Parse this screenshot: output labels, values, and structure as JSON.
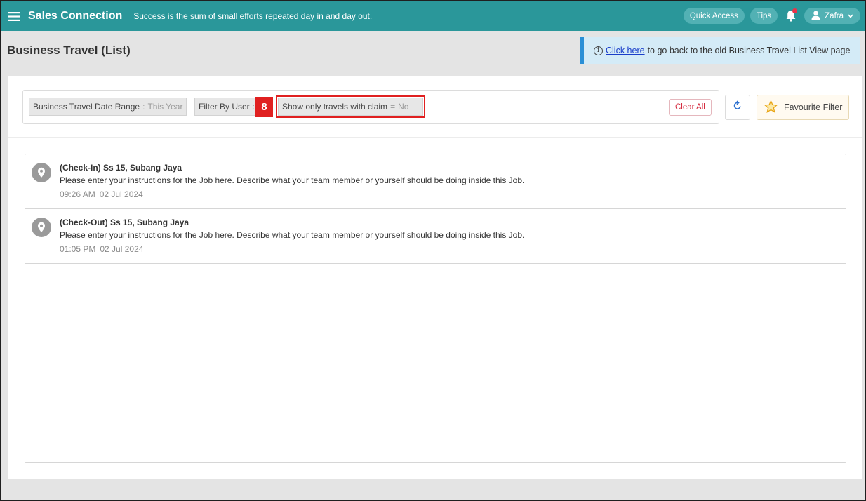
{
  "header": {
    "brand": "Sales Connection",
    "motto": "Success is the sum of small efforts repeated day in and day out.",
    "quick_access": "Quick Access",
    "tips": "Tips",
    "user_name": "Zafra",
    "icons": [
      "hamburger-icon",
      "bell-icon",
      "user-icon",
      "chevron-down-icon"
    ],
    "bg_color": "#2a979a"
  },
  "page": {
    "title": "Business Travel (List)",
    "banner": {
      "info_symbol": "i",
      "link_text": "Click here",
      "text": "to go back to the old Business Travel List View page"
    }
  },
  "filters": {
    "chips": [
      {
        "label": "Business Travel Date Range",
        "sep": ":",
        "value": "This Year"
      },
      {
        "label": "Filter By User",
        "sep": ":",
        "value": ""
      },
      {
        "label": "Show only travels with claim",
        "sep": "=",
        "value": "No"
      }
    ],
    "annotation_badge": "8",
    "clear_all": "Clear All",
    "favourite": "Favourite Filter"
  },
  "travels": [
    {
      "title": "(Check-In) Ss 15, Subang Jaya",
      "description": "Please enter your instructions for the Job here. Describe what your team member or yourself should be doing inside this Job.",
      "time": "09:26 AM",
      "date": "02 Jul 2024"
    },
    {
      "title": "(Check-Out) Ss 15, Subang Jaya",
      "description": "Please enter your instructions for the Job here. Describe what your team member or yourself should be doing inside this Job.",
      "time": "01:05 PM",
      "date": "02 Jul 2024"
    }
  ]
}
